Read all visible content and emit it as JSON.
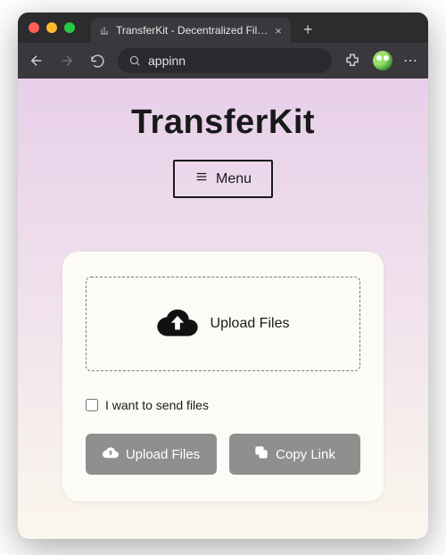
{
  "browser": {
    "tab_title": "TransferKit - Decentralized Fil…",
    "address_value": "appinn"
  },
  "page": {
    "brand": "TransferKit",
    "menu_label": "Menu",
    "dropzone_label": "Upload Files",
    "checkbox_label": "I want to send files",
    "upload_btn": "Upload Files",
    "copy_btn": "Copy Link"
  }
}
